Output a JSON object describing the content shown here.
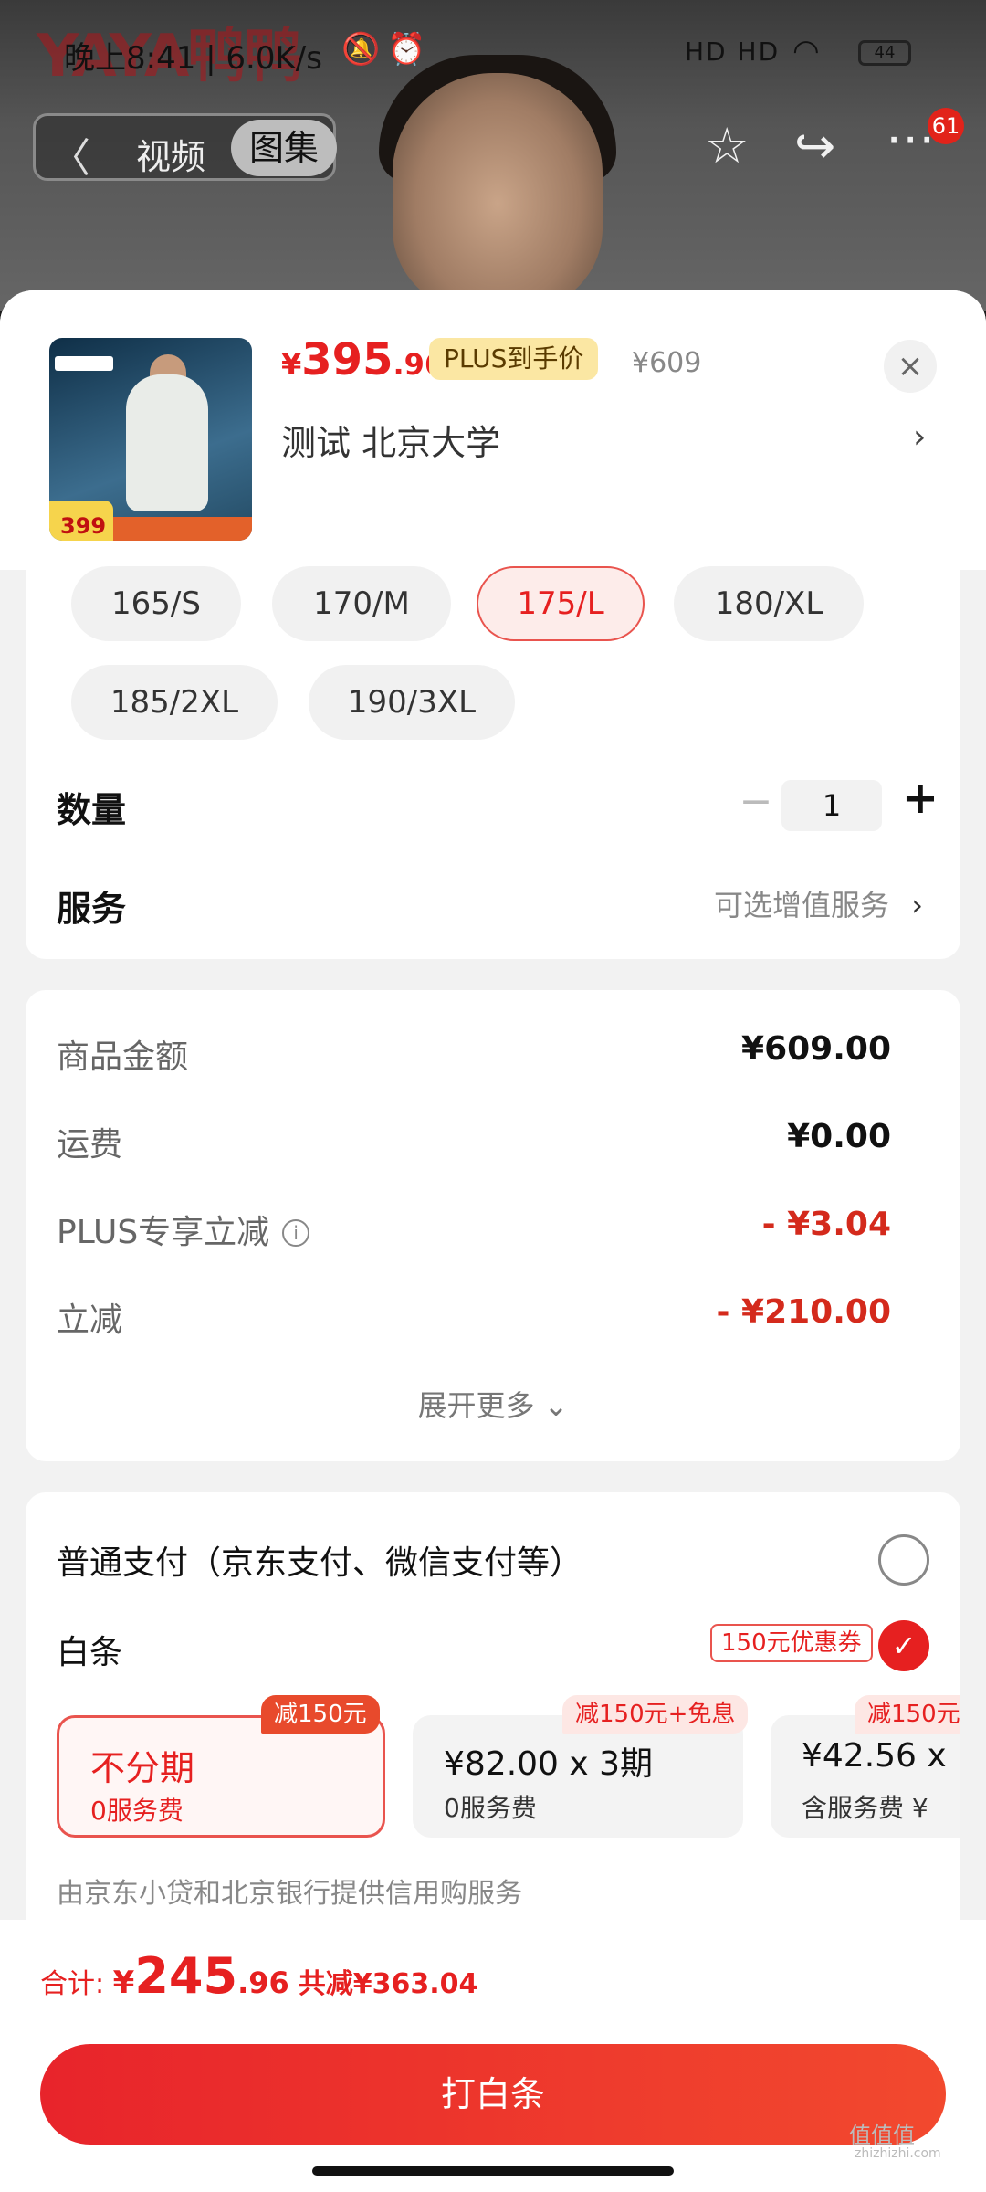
{
  "status_bar": {
    "time": "晚上8:41 | 6.0K/s",
    "signal": "HD HD",
    "battery": "44"
  },
  "background": {
    "brand": "YAYA鸭鸭"
  },
  "top_nav": {
    "back": "〈",
    "tab_video": "视频",
    "tab_gallery": "图集",
    "badge_count": "61"
  },
  "product": {
    "thumb_price": "399",
    "price_symbol": "¥",
    "price_int": "395",
    "price_dec": ".96",
    "plus_tag": "PLUS到手价",
    "original_price": "¥609",
    "selection_text": "测试  北京大学",
    "close": "×",
    "more_arrow": "›"
  },
  "sizes": [
    {
      "label": "165/S",
      "selected": false
    },
    {
      "label": "170/M",
      "selected": false
    },
    {
      "label": "175/L",
      "selected": true
    },
    {
      "label": "180/XL",
      "selected": false
    },
    {
      "label": "185/2XL",
      "selected": false
    },
    {
      "label": "190/3XL",
      "selected": false
    }
  ],
  "quantity": {
    "label": "数量",
    "minus": "−",
    "value": "1",
    "plus": "+"
  },
  "service": {
    "label": "服务",
    "value": "可选增值服务",
    "arrow": "›"
  },
  "fees": {
    "rows": [
      {
        "label": "商品金额",
        "value": "¥609.00",
        "red": false
      },
      {
        "label": "运费",
        "value": "¥0.00",
        "red": false
      },
      {
        "label": "PLUS专享立减",
        "value": "- ¥3.04",
        "red": true
      },
      {
        "label": "立减",
        "value": "- ¥210.00",
        "red": true
      }
    ],
    "info": "i",
    "expand": "展开更多 ⌄"
  },
  "payment": {
    "normal_label": "普通支付（京东支付、微信支付等）",
    "baitiao_label": "白条",
    "coupon": "150元优惠券",
    "check": "✓",
    "plans": [
      {
        "tag": "减150元",
        "top": "不分期",
        "bottom": "0服务费",
        "selected": true
      },
      {
        "tag": "减150元+免息",
        "top": "¥82.00 x 3期",
        "bottom": "0服务费",
        "selected": false
      },
      {
        "tag": "减150元",
        "top": "¥42.56 x",
        "bottom": "含服务费 ¥",
        "selected": false
      }
    ],
    "credit_note": "由京东小贷和北京银行提供信用购服务"
  },
  "footer": {
    "total_label": "合计: ",
    "total_symbol": "¥",
    "total_int": "245",
    "total_dec": ".96",
    "saved": "共减¥363.04",
    "pay_button": "打白条"
  },
  "watermark": {
    "text": "值值值",
    "site": "zhizhizhi.com"
  },
  "colors": {
    "accent": "#e62020",
    "button": "#ef2f2f",
    "plus_tag": "#fbe7a3"
  }
}
